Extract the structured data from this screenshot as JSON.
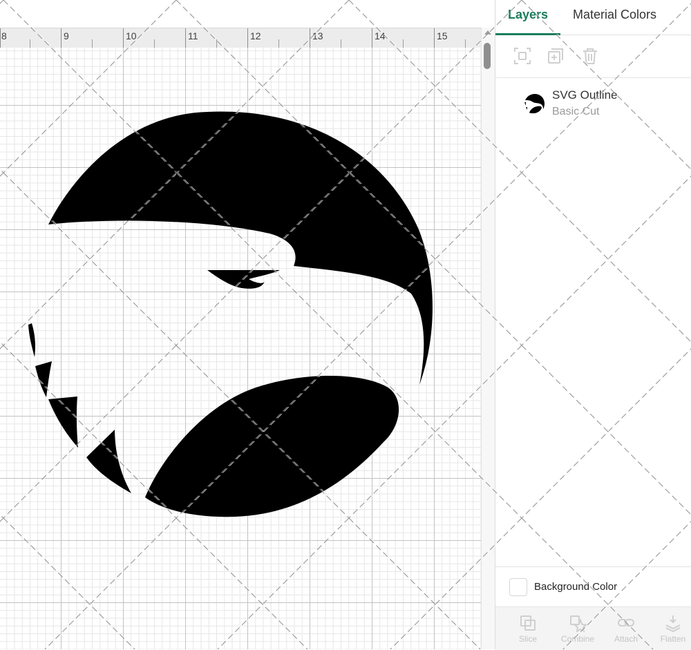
{
  "canvas": {
    "ruler_labels": [
      "8",
      "9",
      "10",
      "11",
      "12",
      "13",
      "14",
      "15"
    ],
    "artwork_name": "bird-head-logo"
  },
  "panel": {
    "tabs": [
      {
        "label": "Layers",
        "active": true
      },
      {
        "label": "Material Colors",
        "active": false
      }
    ],
    "toolbar_icons": [
      "group-icon",
      "duplicate-icon",
      "delete-icon"
    ],
    "layers": [
      {
        "name": "SVG Outline",
        "operation": "Basic Cut"
      }
    ],
    "background_color_label": "Background Color",
    "bottom_actions": [
      {
        "label": "Slice",
        "icon": "slice-icon"
      },
      {
        "label": "Combine",
        "icon": "combine-icon"
      },
      {
        "label": "Attach",
        "icon": "attach-icon"
      },
      {
        "label": "Flatten",
        "icon": "flatten-icon"
      }
    ]
  },
  "colors": {
    "accent": "#1a7d5c",
    "artwork": "#000000",
    "disabled": "#c4c4c4"
  }
}
